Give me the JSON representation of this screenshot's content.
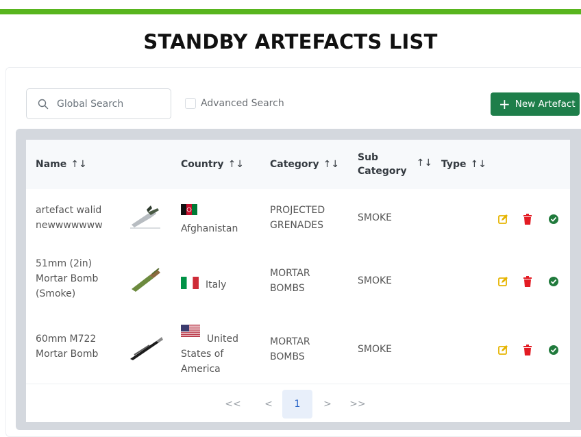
{
  "page": {
    "title": "STANDBY ARTEFACTS LIST"
  },
  "toolbar": {
    "search_placeholder": "Global Search",
    "advanced_search_label": "Advanced Search",
    "new_button_label": "New Artefact",
    "new_button_icon": "plus-icon",
    "search_icon": "search-icon"
  },
  "colors": {
    "accent_green": "#58b51e",
    "button_green": "#1e7e4a",
    "edit": "#e6b400",
    "delete": "#e31b23",
    "confirm": "#207a3c"
  },
  "table": {
    "headers": {
      "name": "Name",
      "country": "Country",
      "category": "Category",
      "sub_category_1": "Sub",
      "sub_category_2": "Category",
      "type": "Type",
      "sort_icon": "↑↓"
    },
    "rows": [
      {
        "name_1": "artefact walid",
        "name_2": "newwwwwww",
        "name_3": "",
        "country_1": "",
        "country_2": "Afghanistan",
        "country_3": "",
        "flag": "afghanistan-flag",
        "category_1": "PROJECTED",
        "category_2": "GRENADES",
        "sub_category": "SMOKE",
        "type": ""
      },
      {
        "name_1": "51mm (2in)",
        "name_2": "Mortar Bomb",
        "name_3": "(Smoke)",
        "country_1": "Italy",
        "country_2": "",
        "country_3": "",
        "flag": "italy-flag",
        "category_1": "MORTAR",
        "category_2": "BOMBS",
        "sub_category": "SMOKE",
        "type": ""
      },
      {
        "name_1": "60mm M722",
        "name_2": "Mortar Bomb",
        "name_3": "",
        "country_1": "United",
        "country_2": "States of",
        "country_3": "America",
        "flag": "usa-flag",
        "category_1": "MORTAR",
        "category_2": "BOMBS",
        "sub_category": "SMOKE",
        "type": ""
      }
    ],
    "actions": [
      "edit-icon",
      "trash-icon",
      "check-circle-icon"
    ]
  },
  "pagination": {
    "first": "<<",
    "prev": "<",
    "current": "1",
    "next": ">",
    "last": ">>"
  }
}
